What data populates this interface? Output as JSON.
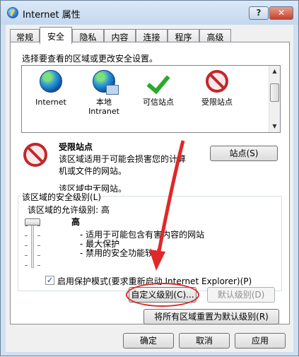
{
  "window": {
    "title": "Internet 属性",
    "help_label": "?",
    "close_label": "✕"
  },
  "tabs": [
    "常规",
    "安全",
    "隐私",
    "内容",
    "连接",
    "程序",
    "高级"
  ],
  "active_tab": "安全",
  "security": {
    "select_zone_prompt": "选择要查看的区域或更改安全设置。",
    "zones": [
      {
        "label": "Internet",
        "icon": "globe-icon"
      },
      {
        "label": "本地\nIntranet",
        "icon": "local-intranet-icon"
      },
      {
        "label": "可信站点",
        "icon": "checkmark-icon"
      },
      {
        "label": "受限站点",
        "icon": "restricted-icon"
      }
    ],
    "selected_zone": {
      "title": "受限站点",
      "description_line1": "该区域适用于可能会损害您的计算",
      "description_line2": "机或文件的网站。",
      "sites_note": "该区域中无网站。",
      "sites_button": "站点(S)"
    },
    "level_group": {
      "label": "该区域的安全级别(L)",
      "allowed_levels": "该区域的允许级别: 高",
      "level_name": "高",
      "bullets": [
        "- 适用于可能包含有害内容的网站",
        "- 最大保护",
        "- 禁用的安全功能较少"
      ],
      "slider_level": "高"
    },
    "protected_mode": {
      "label": "启用保护模式(要求重新启动 Internet Explorer)(P)",
      "checked": true
    },
    "custom_level_button": "自定义级别(C)...",
    "default_level_button": "默认级别(D)",
    "reset_all_button": "将所有区域重置为默认级别(R)"
  },
  "footer": {
    "ok": "确定",
    "cancel": "取消",
    "apply": "应用"
  },
  "annotation_color": "#e02828"
}
